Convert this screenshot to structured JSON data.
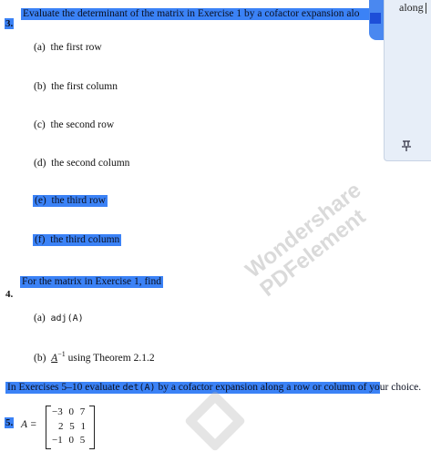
{
  "q3": {
    "number": "3.",
    "prompt": "Evaluate the determinant of the matrix in Exercise 1 by a cofactor expansion alo",
    "parts": [
      {
        "label": "(a)",
        "text": "the first row"
      },
      {
        "label": "(b)",
        "text": "the first column"
      },
      {
        "label": "(c)",
        "text": "the second row"
      },
      {
        "label": "(d)",
        "text": "the second column"
      },
      {
        "label": "(e)",
        "text": "the third row"
      },
      {
        "label": "(f)",
        "text": "the third column"
      }
    ]
  },
  "q4": {
    "number": "4.",
    "prompt": "For the matrix in Exercise 1, find",
    "a_label": "(a)",
    "a_text": "adj(A)",
    "b_label": "(b)",
    "b_sym": "A",
    "b_sup": "−1",
    "b_text": "using Theorem 2.1.2"
  },
  "instructions": {
    "pre": "In Exercises 5–10 evaluate",
    "mid": "det(A)",
    "post": "by a cofactor expansion along a row or column of your choice."
  },
  "q5": {
    "number": "5.",
    "lhs": "A =",
    "rows": [
      "−3 0 7",
      "2 5 1",
      "−1 0 5"
    ]
  },
  "side_panel": {
    "word": "along",
    "pin_icon": "pin-icon"
  },
  "watermark": {
    "line1": "Wondershare",
    "line2": "PDFelement"
  },
  "colors": {
    "highlight": "#3b82f6",
    "panel": "#e7eef8"
  }
}
